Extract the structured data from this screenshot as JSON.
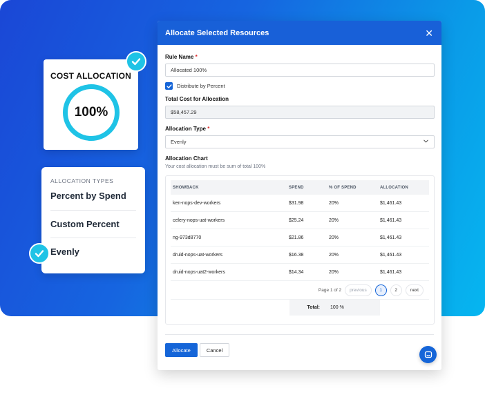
{
  "cost_card": {
    "title": "COST ALLOCATION",
    "value": "100%"
  },
  "types_card": {
    "heading": "ALLOCATION TYPES",
    "items": [
      "Percent by Spend",
      "Custom Percent",
      "Evenly"
    ]
  },
  "modal": {
    "title": "Allocate Selected Resources",
    "rule_name_label": "Rule Name",
    "rule_name_required": "*",
    "rule_name_value": "Allocated 100%",
    "distribute_label": "Distribute by Percent",
    "distribute_checked": true,
    "total_cost_label": "Total Cost for Allocation",
    "total_cost_value": "$58,457.29",
    "type_label": "Allocation Type",
    "type_required": "*",
    "type_value": "Evenly",
    "chart_label": "Allocation Chart",
    "chart_note": "Your cost allocation must be sum of total 100%",
    "table": {
      "headers": [
        "SHOWBACK",
        "SPEND",
        "% OF SPEND",
        "ALLOCATION"
      ],
      "rows": [
        [
          "ken-nops-dev-workers",
          "$31.98",
          "20%",
          "$1,461.43"
        ],
        [
          "celery-nops-uat-workers",
          "$25.24",
          "20%",
          "$1,461.43"
        ],
        [
          "ng-973d8770",
          "$21.86",
          "20%",
          "$1,461.43"
        ],
        [
          "druid-nops-uat-workers",
          "$16.38",
          "20%",
          "$1,461.43"
        ],
        [
          "druid-nops-uat2-workers",
          "$14.34",
          "20%",
          "$1,461.43"
        ]
      ]
    },
    "pager": {
      "info": "Page 1 of 2",
      "previous": "previous",
      "pages": [
        "1",
        "2"
      ],
      "next": "next"
    },
    "total_label": "Total:",
    "total_value": "100 %",
    "allocate_button": "Allocate",
    "cancel_button": "Cancel"
  },
  "colors": {
    "accent": "#1565d8",
    "ring": "#1fc3e6",
    "header": "#1860d8"
  }
}
